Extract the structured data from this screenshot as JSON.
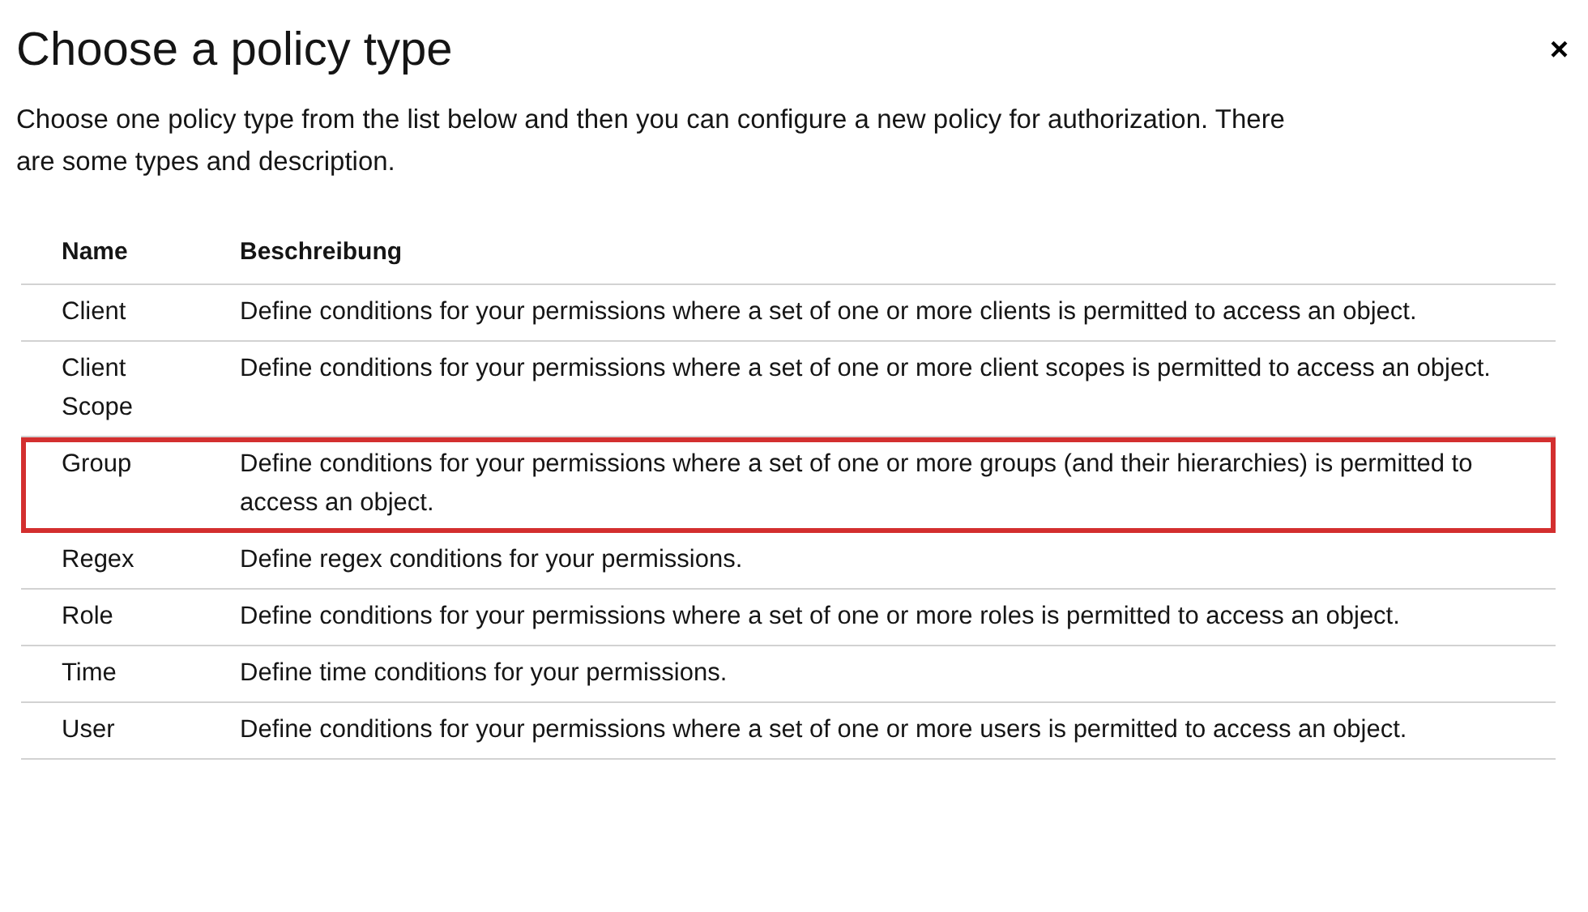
{
  "dialog": {
    "title": "Choose a policy type",
    "close": "×",
    "description": "Choose one policy type from the list below and then you can configure a new policy for authorization. There are some types and description."
  },
  "table": {
    "columns": [
      "Name",
      "Beschreibung"
    ],
    "rows": [
      {
        "name": "Client",
        "description": "Define conditions for your permissions where a set of one or more clients is permitted to access an object.",
        "highlighted": false
      },
      {
        "name": "Client Scope",
        "description": "Define conditions for your permissions where a set of one or more client scopes is permitted to access an object.",
        "highlighted": false
      },
      {
        "name": "Group",
        "description": "Define conditions for your permissions where a set of one or more groups (and their hierarchies) is permitted to access an object.",
        "highlighted": true
      },
      {
        "name": "Regex",
        "description": "Define regex conditions for your permissions.",
        "highlighted": false
      },
      {
        "name": "Role",
        "description": "Define conditions for your permissions where a set of one or more roles is permitted to access an object.",
        "highlighted": false
      },
      {
        "name": "Time",
        "description": "Define time conditions for your permissions.",
        "highlighted": false
      },
      {
        "name": "User",
        "description": "Define conditions for your permissions where a set of one or more users is permitted to access an object.",
        "highlighted": false
      }
    ]
  }
}
